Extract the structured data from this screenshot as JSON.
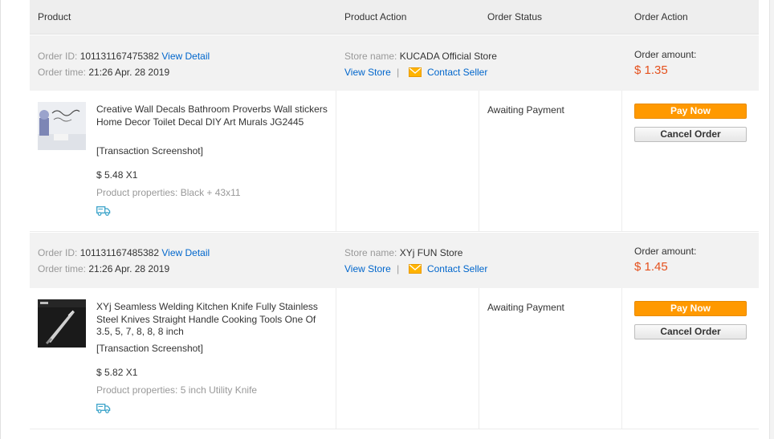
{
  "columns": {
    "product": "Product",
    "product_action": "Product Action",
    "order_status": "Order Status",
    "order_action": "Order Action"
  },
  "labels": {
    "order_id": "Order ID:",
    "order_time": "Order time:",
    "view_detail": "View Detail",
    "store_name": "Store name:",
    "view_store": "View Store",
    "separator": "|",
    "contact_seller": "Contact Seller",
    "order_amount": "Order amount:",
    "transaction_screenshot": "[Transaction Screenshot]",
    "product_properties": "Product properties:",
    "pay_now": "Pay Now",
    "cancel_order": "Cancel Order"
  },
  "orders": [
    {
      "order_id": "101131167475382",
      "order_time": "21:26 Apr. 28 2019",
      "store_name": "KUCADA Official Store",
      "amount": "$ 1.35",
      "product_title": "Creative Wall Decals Bathroom Proverbs Wall stickers Home Decor Toilet Decal DIY Art Murals JG2445",
      "price_qty": "$ 5.48 X1",
      "properties": "Black + 43x11",
      "status": "Awaiting Payment"
    },
    {
      "order_id": "101131167485382",
      "order_time": "21:26 Apr. 28 2019",
      "store_name": "XYj FUN Store",
      "amount": "$ 1.45",
      "product_title": "XYj Seamless Welding Kitchen Knife Fully Stainless Steel Knives Straight Handle Cooking Tools One Of 3.5, 5, 7, 8, 8, 8 inch",
      "price_qty": "$ 5.82 X1",
      "properties": "5 inch Utility Knife",
      "status": "Awaiting Payment"
    }
  ],
  "colors": {
    "accent_orange": "#ff9900",
    "amount_red": "#e5511d",
    "link_blue": "#0066cc",
    "icon_teal": "#3aa3c9"
  },
  "icons": {
    "mail": "envelope-icon",
    "shipping": "truck-icon"
  }
}
